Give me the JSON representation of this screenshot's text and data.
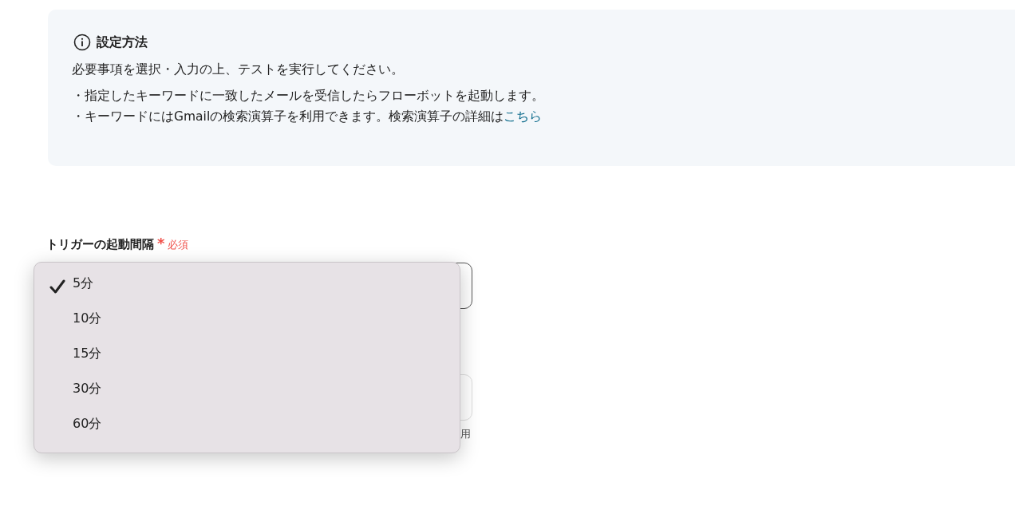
{
  "info": {
    "title": "設定方法",
    "intro": "必要事項を選択・入力の上、テストを実行してください。",
    "bullets": [
      {
        "text": "・指定したキーワードに一致したメールを受信したらフローボットを起動します。"
      },
      {
        "text": "・キーワードにはGmailの検索演算子を利用できます。検索演算子の詳細は",
        "link": "こちら"
      }
    ]
  },
  "field": {
    "label": "トリガーの起動間隔",
    "required": true,
    "required_mark": "*",
    "required_text": "必須"
  },
  "dropdown": {
    "options": [
      {
        "label": "5分",
        "selected": true
      },
      {
        "label": "10分",
        "selected": false
      },
      {
        "label": "15分",
        "selected": false
      },
      {
        "label": "30分",
        "selected": false
      },
      {
        "label": "60分",
        "selected": false
      }
    ]
  },
  "second_field": {
    "helper": "用"
  }
}
